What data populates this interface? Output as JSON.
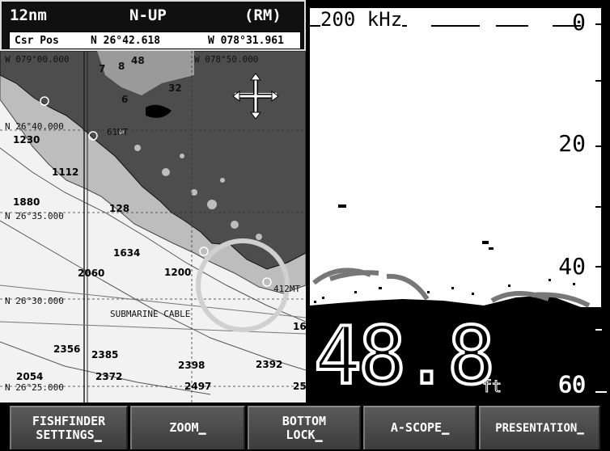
{
  "chart": {
    "range": "12nm",
    "orientation": "N-UP",
    "motion_mode": "(RM)",
    "cursor_label": "Csr Pos",
    "cursor_lat": "N  26°42.618",
    "cursor_lon": "W 078°31.961",
    "grid_labels": [
      "W 079°00.000",
      "W 078°50.000",
      "N 26°40.000",
      "N 26°35.000",
      "N 26°30.000",
      "N 26°25.000"
    ],
    "depths": [
      "48",
      "7",
      "8",
      "32",
      "6",
      "1230",
      "1112",
      "1880",
      "128",
      "1634",
      "2060",
      "1200",
      "2356",
      "2385",
      "2398",
      "2392",
      "2054",
      "2372",
      "2497",
      "16",
      "25"
    ],
    "features": [
      "61MT",
      "412MT",
      "SUBMARINE CABLE"
    ],
    "cursor_icon": "move-cursor-icon"
  },
  "fishfinder": {
    "frequency": "200 kHz",
    "scale": [
      "0",
      "20",
      "40",
      "60"
    ],
    "depth": "48.8",
    "unit": "ft"
  },
  "softkeys": {
    "fishfinder_line1": "FISHFINDER",
    "fishfinder_line2": "SETTINGS",
    "zoom": "ZOOM",
    "bottom_line1": "BOTTOM",
    "bottom_line2": "LOCK",
    "ascope": "A-SCOPE",
    "presentation": "PRESENTATION"
  },
  "colors": {
    "deep_water": "#f2f2f2",
    "shallow_water": "#bdbdbd",
    "land": "#4d4d4d",
    "bottom_echo": "#000000",
    "background": "#000000"
  }
}
